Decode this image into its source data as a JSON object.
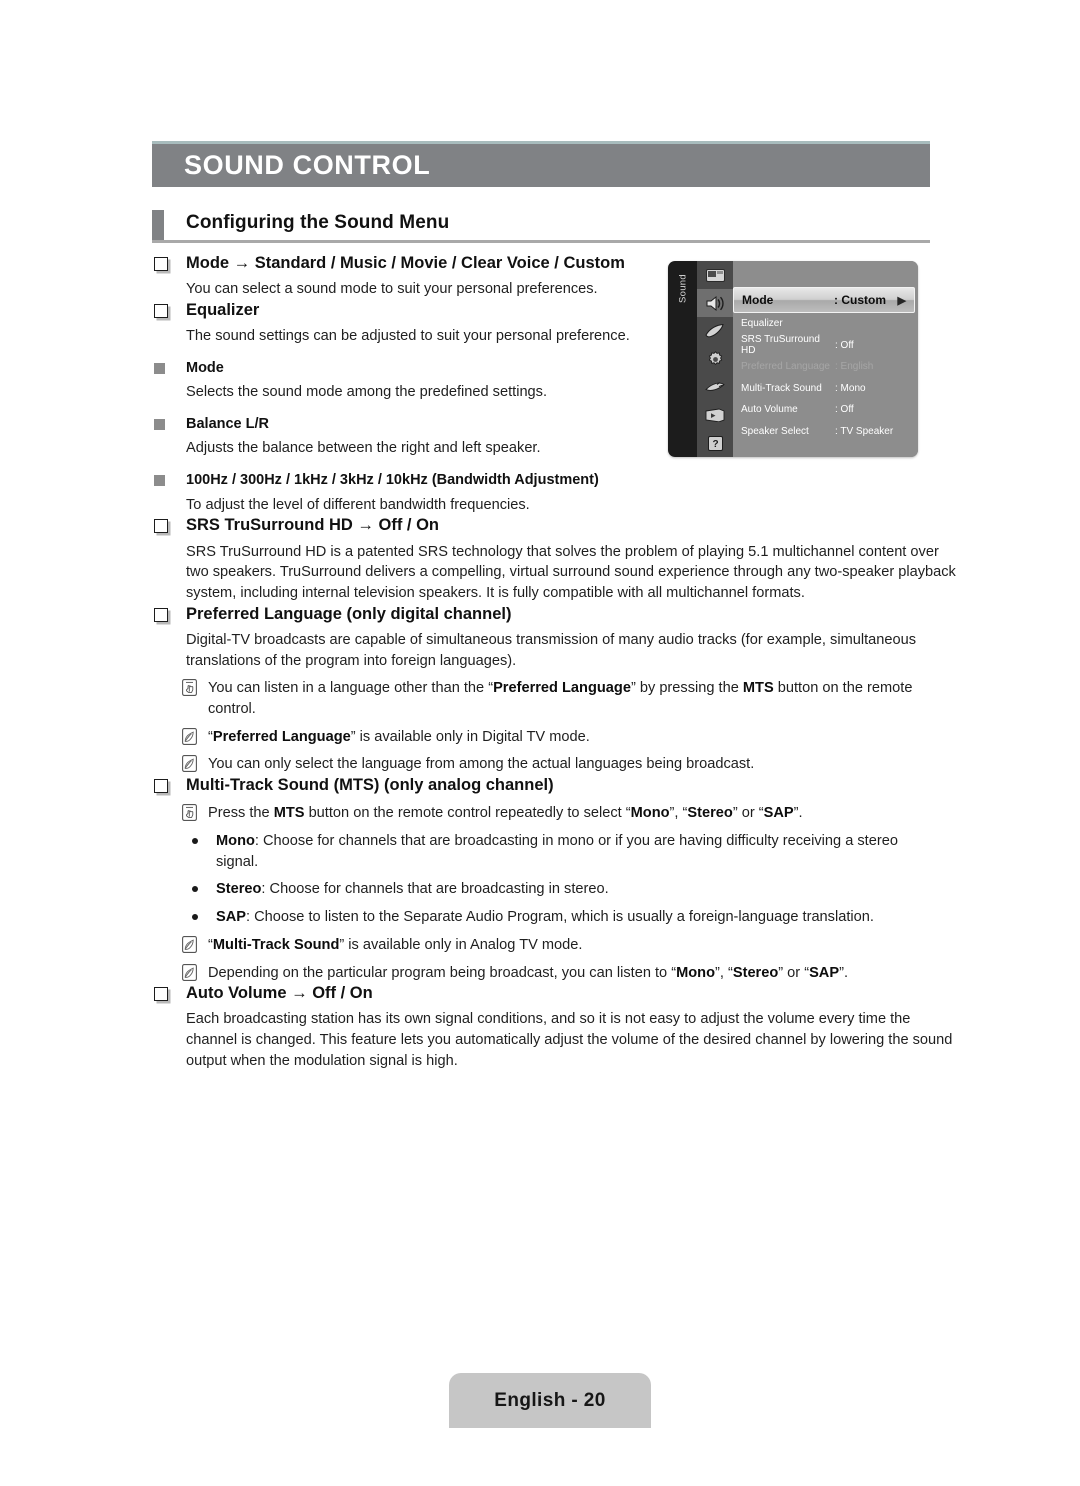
{
  "page": {
    "chapter_title": "SOUND CONTROL",
    "section_title": "Configuring the Sound Menu",
    "footer_label": "English - 20",
    "accent_gray": "#808285",
    "accent_teal": "#a8bcbd",
    "footer_bg": "#c6c6c6"
  },
  "sections": {
    "mode": {
      "heading": "Mode → Standard / Music / Movie / Clear Voice / Custom",
      "body": "You can select a sound mode to suit your personal preferences."
    },
    "equalizer": {
      "heading": "Equalizer",
      "body": "The sound settings can be adjusted to suit your personal preference.",
      "sub": [
        {
          "heading": "Mode",
          "body": "Selects the sound mode among the predefined settings."
        },
        {
          "heading": "Balance L/R",
          "body": "Adjusts the balance between the right and left speaker."
        },
        {
          "heading": "100Hz / 300Hz / 1kHz / 3kHz / 10kHz (Bandwidth Adjustment)",
          "body": "To adjust the level of different bandwidth frequencies."
        }
      ]
    },
    "srs": {
      "heading": "SRS TruSurround HD → Off / On",
      "body": "SRS TruSurround HD is a patented SRS technology that solves the problem of playing 5.1 multichannel content over two speakers. TruSurround delivers a compelling, virtual surround sound experience through any two-speaker playback system, including internal television speakers. It is fully compatible with all multichannel formats."
    },
    "preferred_language": {
      "heading": "Preferred Language (only digital channel)",
      "body": "Digital-TV broadcasts are capable of simultaneous transmission of many audio tracks (for example, simultaneous translations of the program into foreign languages).",
      "notes": [
        {
          "icon": "hand-note-icon",
          "text_html": "You can listen in a language other than the “<b>Preferred Language</b>” by pressing the <b>MTS</b> button on the remote control."
        },
        {
          "icon": "pencil-note-icon",
          "text_html": "“<b>Preferred Language</b>” is available only in Digital TV mode."
        },
        {
          "icon": "pencil-note-icon",
          "text_html": "You can only select the language from among the actual languages being broadcast."
        }
      ]
    },
    "mts": {
      "heading": "Multi-Track Sound (MTS) (only analog channel)",
      "notes_top": [
        {
          "icon": "hand-note-icon",
          "text_html": "Press the <b>MTS</b> button on the remote control repeatedly to select “<b>Mono</b>”, “<b>Stereo</b>” or “<b>SAP</b>”."
        }
      ],
      "bullets": [
        {
          "text_html": "<b>Mono</b>: Choose for channels that are broadcasting in mono or if you are having difficulty receiving a stereo signal."
        },
        {
          "text_html": "<b>Stereo</b>: Choose for channels that are broadcasting in stereo."
        },
        {
          "text_html": "<b>SAP</b>: Choose to listen to the Separate Audio Program, which is usually a foreign-language translation."
        }
      ],
      "notes_bottom": [
        {
          "icon": "pencil-note-icon",
          "text_html": "“<b>Multi-Track Sound</b>” is available only in Analog TV mode."
        },
        {
          "icon": "pencil-note-icon",
          "text_html": "Depending on the particular program being broadcast, you can listen to “<b>Mono</b>”, “<b>Stereo</b>” or “<b>SAP</b>”."
        }
      ]
    },
    "auto_volume": {
      "heading": "Auto Volume → Off / On",
      "body": "Each broadcasting station has its own signal conditions, and so it is not easy to adjust the volume every time the channel is changed. This feature lets you automatically adjust the volume of the desired channel by lowering the sound output when the modulation signal is high."
    }
  },
  "osd": {
    "rail_label": "Sound",
    "sidebar_icons": [
      {
        "name": "picture-icon",
        "selected": false
      },
      {
        "name": "sound-speaker-icon",
        "selected": true
      },
      {
        "name": "channel-antenna-icon",
        "selected": false
      },
      {
        "name": "setup-gear-icon",
        "selected": false
      },
      {
        "name": "input-plug-icon",
        "selected": false
      },
      {
        "name": "media-play-icon",
        "selected": false
      },
      {
        "name": "support-question-icon",
        "selected": false
      }
    ],
    "rows": [
      {
        "label": "Mode",
        "value": ": Custom",
        "state": "highlighted",
        "arrow": "▶"
      },
      {
        "label": "Equalizer",
        "value": "",
        "state": "normal"
      },
      {
        "label": "SRS TruSurround HD",
        "value": ": Off",
        "state": "normal"
      },
      {
        "label": "Preferred Language",
        "value": ": English",
        "state": "disabled"
      },
      {
        "label": "Multi-Track Sound",
        "value": ": Mono",
        "state": "normal"
      },
      {
        "label": "Auto Volume",
        "value": ": Off",
        "state": "normal"
      },
      {
        "label": "Speaker Select",
        "value": ": TV Speaker",
        "state": "normal"
      }
    ]
  }
}
